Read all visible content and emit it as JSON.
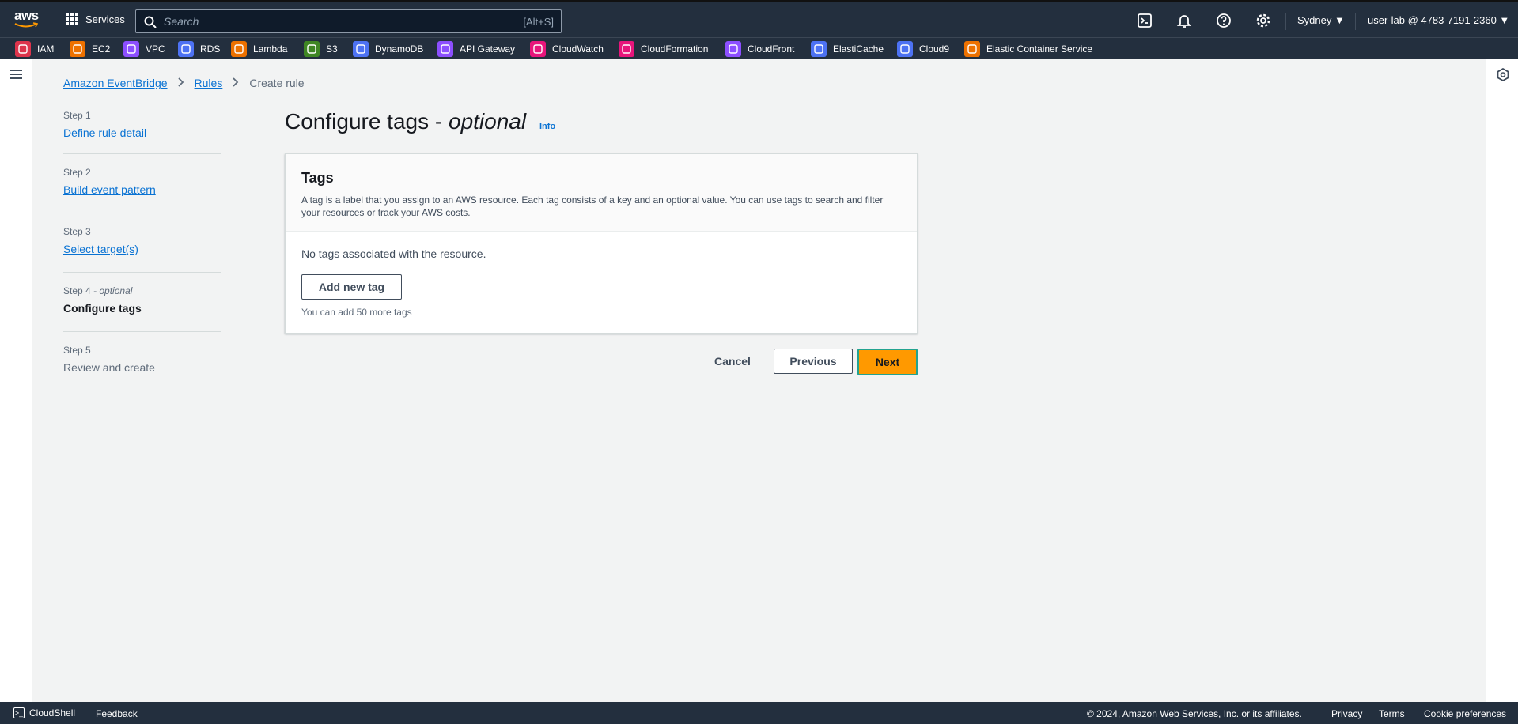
{
  "topbar": {
    "services_label": "Services",
    "search_placeholder": "Search",
    "search_shortcut": "[Alt+S]",
    "region": "Sydney ▼",
    "account": "user-lab @ 4783-7191-2360 ▼"
  },
  "favorites": [
    {
      "label": "IAM",
      "color": "#dd344c",
      "icon": "iam-icon"
    },
    {
      "label": "EC2",
      "color": "#ed7100",
      "icon": "ec2-icon"
    },
    {
      "label": "VPC",
      "color": "#8c4fff",
      "icon": "vpc-icon"
    },
    {
      "label": "RDS",
      "color": "#4d72f3",
      "icon": "rds-icon"
    },
    {
      "label": "Lambda",
      "color": "#ed7100",
      "icon": "lambda-icon"
    },
    {
      "label": "S3",
      "color": "#3f8624",
      "icon": "s3-icon"
    },
    {
      "label": "DynamoDB",
      "color": "#4d72f3",
      "icon": "dynamodb-icon"
    },
    {
      "label": "API Gateway",
      "color": "#8c4fff",
      "icon": "api-gateway-icon"
    },
    {
      "label": "CloudWatch",
      "color": "#e7157b",
      "icon": "cloudwatch-icon"
    },
    {
      "label": "CloudFormation",
      "color": "#e7157b",
      "icon": "cloudformation-icon"
    },
    {
      "label": "CloudFront",
      "color": "#8c4fff",
      "icon": "cloudfront-icon"
    },
    {
      "label": "ElastiCache",
      "color": "#4d72f3",
      "icon": "elasticache-icon"
    },
    {
      "label": "Cloud9",
      "color": "#4d72f3",
      "icon": "cloud9-icon"
    },
    {
      "label": "Elastic Container Service",
      "color": "#ed7100",
      "icon": "ecs-icon"
    }
  ],
  "breadcrumb": {
    "items": [
      "Amazon EventBridge",
      "Rules"
    ],
    "current": "Create rule"
  },
  "steps": [
    {
      "number": "Step 1",
      "label": "Define rule detail",
      "state": "link"
    },
    {
      "number": "Step 2",
      "label": "Build event pattern",
      "state": "link"
    },
    {
      "number": "Step 3",
      "label": "Select target(s)",
      "state": "link"
    },
    {
      "number": "Step 4",
      "number_suffix": "- optional",
      "label": "Configure tags",
      "state": "active"
    },
    {
      "number": "Step 5",
      "label": "Review and create",
      "state": "disabled"
    }
  ],
  "page": {
    "title": "Configure tags - ",
    "title_italic": "optional",
    "info_link": "Info"
  },
  "tags_card": {
    "heading": "Tags",
    "description": "A tag is a label that you assign to an AWS resource. Each tag consists of a key and an optional value. You can use tags to search and filter your resources or track your AWS costs.",
    "empty_text": "No tags associated with the resource.",
    "add_button": "Add new tag",
    "limit_text": "You can add 50 more tags"
  },
  "actions": {
    "cancel": "Cancel",
    "previous": "Previous",
    "next": "Next"
  },
  "footer": {
    "cloudshell": "CloudShell",
    "feedback": "Feedback",
    "copyright": "© 2024, Amazon Web Services, Inc. or its affiliates.",
    "privacy": "Privacy",
    "terms": "Terms",
    "cookies": "Cookie preferences"
  }
}
